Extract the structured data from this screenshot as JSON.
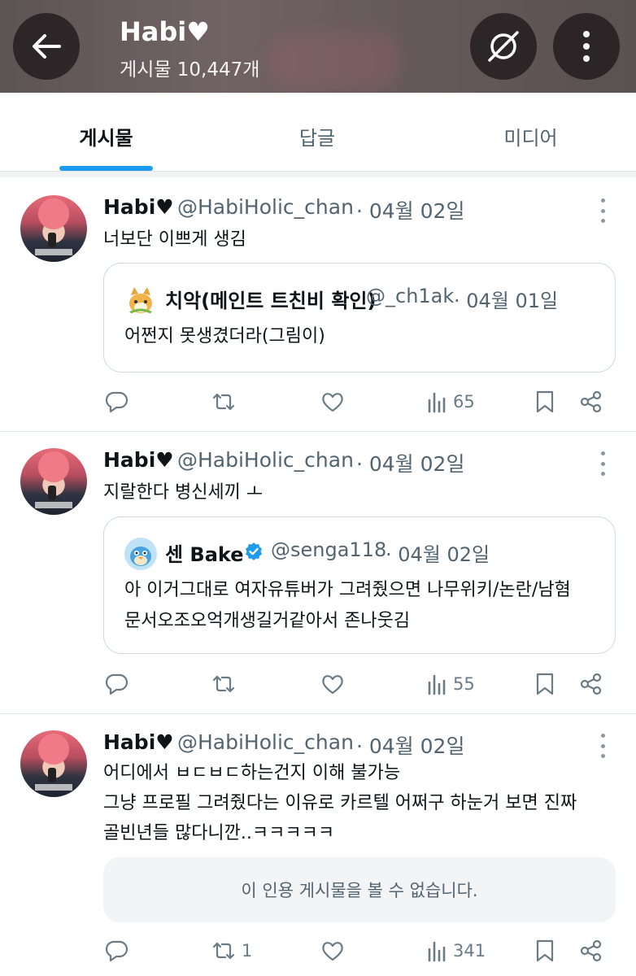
{
  "header": {
    "profile_name": "Habi♥",
    "post_count_label": "게시물 10,447개"
  },
  "tabs": [
    {
      "label": "게시물",
      "active": true
    },
    {
      "label": "답글",
      "active": false
    },
    {
      "label": "미디어",
      "active": false
    }
  ],
  "posts": [
    {
      "name": "Habi♥",
      "handle": "@HabiHolic_chan",
      "date": "· 04월 02일",
      "lines": [
        "너보단 이쁘게 생김"
      ],
      "quote": {
        "name": "치악(메인트 트친비 확인)",
        "handle": "@_ch1ak",
        "date": "· 04월 01일",
        "verified": false,
        "lines": [
          "어쩐지 못생겼더라(그림이)"
        ]
      },
      "stats": {
        "replies": "",
        "reposts": "",
        "likes": "",
        "views": "65"
      }
    },
    {
      "name": "Habi♥",
      "handle": "@HabiHolic_chan",
      "date": "· 04월 02일",
      "lines": [
        "지랄한다 병신세끼 ㅗ"
      ],
      "quote": {
        "name": "센 Bake",
        "handle": "@senga118",
        "date": "· 04월 02일",
        "verified": true,
        "lines": [
          "아 이거그대로 여자유튜버가 그려줬으면 나무위키/논란/남혐",
          "문서오조오억개생길거같아서 존나웃김"
        ]
      },
      "stats": {
        "replies": "",
        "reposts": "",
        "likes": "",
        "views": "55"
      }
    },
    {
      "name": "Habi♥",
      "handle": "@HabiHolic_chan",
      "date": "· 04월 02일",
      "lines": [
        "어디에서 ㅂㄷㅂㄷ하는건지 이해 불가능",
        "그냥 프로필 그려줬다는 이유로 카르텔 어쩌구 하눈거 보면 진짜",
        "골빈년들 많다니깐..ㅋㅋㅋㅋㅋ"
      ],
      "unavailable_text": "이 인용 게시물을 볼 수 없습니다.",
      "stats": {
        "replies": "",
        "reposts": "1",
        "likes": "",
        "views": "341"
      }
    }
  ],
  "colors": {
    "accent": "#1d9bf0",
    "text": "#0f1419",
    "secondary": "#536471",
    "icon": "#6b7b86",
    "verified": "#1d9bf0"
  }
}
